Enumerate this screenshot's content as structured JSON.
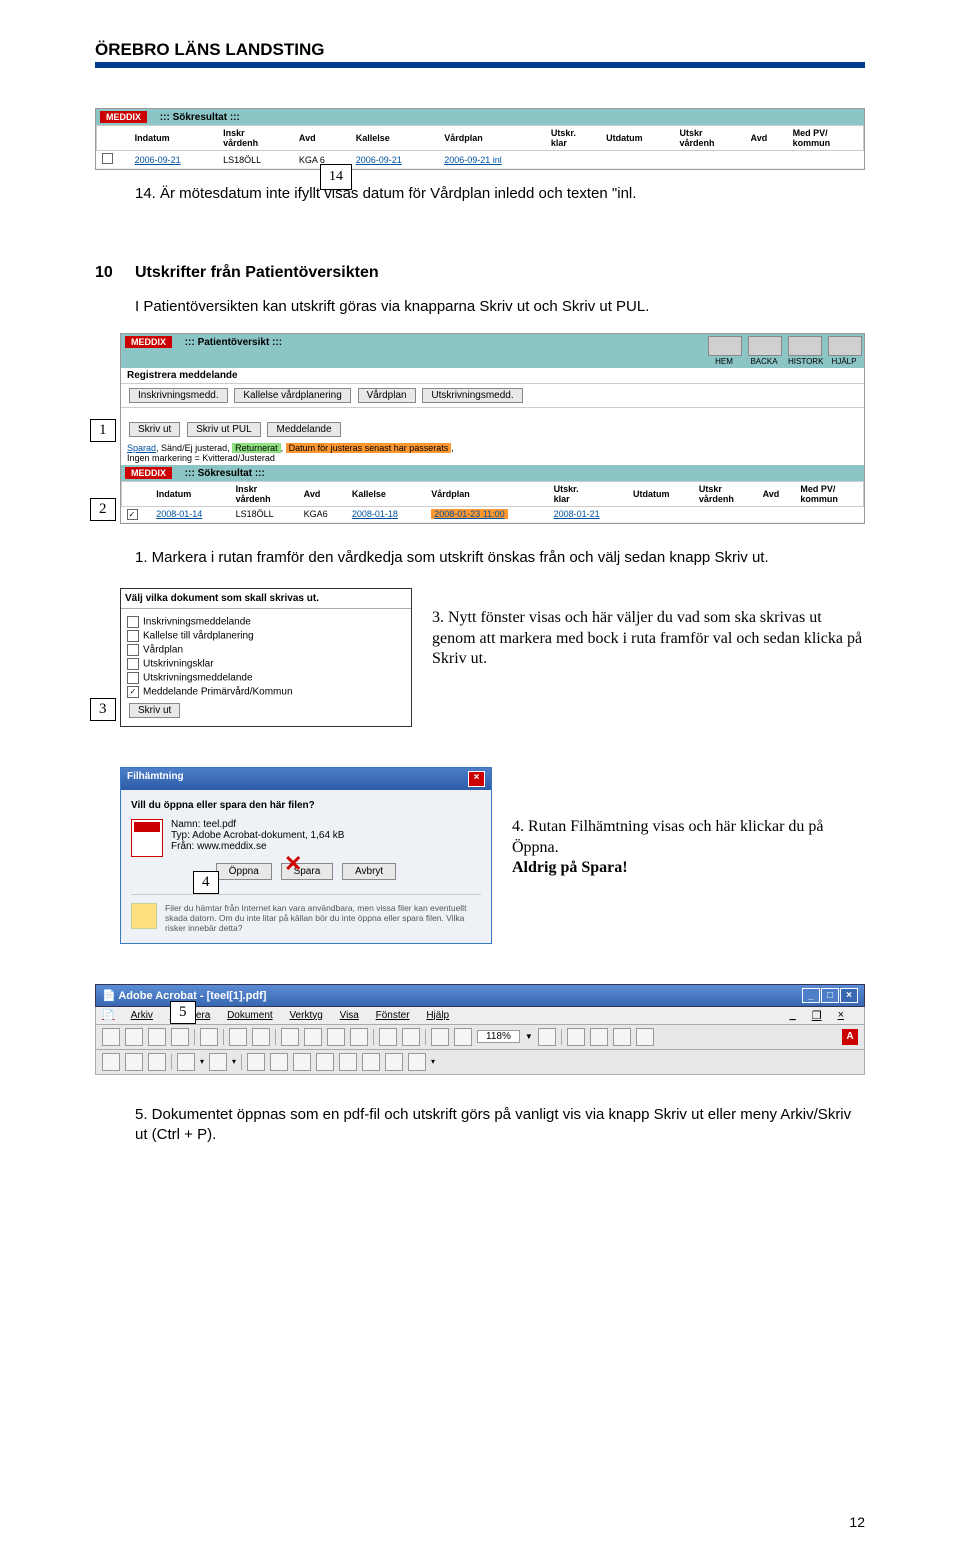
{
  "header": {
    "org": "ÖREBRO LÄNS LANDSTING"
  },
  "sokresultat": {
    "title": "Sökresultat",
    "meddix": "MEDDIX",
    "cols": [
      "Indatum",
      "Inskr\nvårdenh",
      "Avd",
      "Kallelse",
      "Vårdplan",
      "Utskr.\nklar",
      "Utdatum",
      "Utskr\nvårdenh",
      "Avd",
      "Med PV/\nkommun"
    ],
    "row": [
      "2006-09-21",
      "LS18ÖLL",
      "KGA 6",
      "2006-09-21",
      "2006-09-21 inl",
      "",
      "",
      "",
      "",
      ""
    ]
  },
  "callout14": "14",
  "step14_text": "14. Är mötesdatum inte ifyllt visas datum för Vårdplan inledd och texten \"inl.",
  "section10": {
    "num": "10",
    "title": "Utskrifter från Patientöversikten",
    "intro": "I Patientöversikten kan utskrift göras via knapparna Skriv ut och Skriv ut PUL."
  },
  "patientoversikt": {
    "title": "Patientöversikt",
    "meddix": "MEDDIX",
    "nav_icons": [
      "HEM",
      "BACKA",
      "HISTORK",
      "HJÄLP"
    ],
    "registrera": "Registrera meddelande",
    "tabs": [
      "Inskrivningsmedd.",
      "Kallelse vårdplanering",
      "Vårdplan",
      "Utskrivningsmedd."
    ],
    "buttons": [
      "Skriv ut",
      "Skriv ut PUL",
      "Meddelande"
    ],
    "status_line_parts": {
      "sparad": "Sparad",
      "sep1": ", ",
      "sand": "Sänd/Ej justerad",
      "sep2": ", ",
      "returnerat": "Returnerat",
      "sep3": ", ",
      "datum_passerat": "Datum för justeras senast har passerats",
      "sep4": ","
    },
    "marker_line": "Ingen markering = Kvitterad/Justerad",
    "sok_title": "Sökresultat",
    "row": [
      "2008-01-14",
      "LS18ÖLL",
      "KGA6",
      "2008-01-18",
      "2008-01-23 11:00",
      "2008-01-21",
      "",
      "",
      "",
      ""
    ]
  },
  "callout1": "1",
  "callout2": "2",
  "step1_text": "1. Markera i rutan framför den vårdkedja som utskrift önskas från och välj sedan knapp Skriv ut.",
  "print_dialog": {
    "title": "Välj vilka dokument som skall skrivas ut.",
    "options": [
      "Inskrivningsmeddelande",
      "Kallelse till vårdplanering",
      "Vårdplan",
      "Utskrivningsklar",
      "Utskrivningsmeddelande",
      "Meddelande Primärvård/Kommun"
    ],
    "checked_idx": 5,
    "button": "Skriv ut"
  },
  "callout3": "3",
  "step3_text": "3. Nytt fönster visas och här väljer du vad som ska skrivas ut genom att markera med bock i ruta framför val och sedan klicka på Skriv ut.",
  "filedl": {
    "title": "Filhämtning",
    "question": "Vill du öppna eller spara den här filen?",
    "namn_label": "Namn:",
    "namn": "teel.pdf",
    "typ_label": "Typ:",
    "typ": "Adobe Acrobat-dokument, 1,64 kB",
    "fran_label": "Från:",
    "fran": "www.meddix.se",
    "btn_open": "Öppna",
    "btn_save": "Spara",
    "btn_cancel": "Avbryt",
    "footer": "Filer du hämtar från Internet kan vara användbara, men vissa filer kan eventuellt skada datorn. Om du inte litar på källan bör du inte öppna eller spara filen. Vilka risker innebär detta?"
  },
  "callout4": "4",
  "step4_text_a": "4. Rutan Filhämtning visas och här klickar du på Öppna.",
  "step4_text_b": "Aldrig på Spara!",
  "acrobat": {
    "title": "Adobe Acrobat - [teel[1].pdf]",
    "menu": [
      "Arkiv",
      "Redigera",
      "Dokument",
      "Verktyg",
      "Visa",
      "Fönster",
      "Hjälp"
    ],
    "zoom": "118%"
  },
  "callout5": "5",
  "step5_text": "5. Dokumentet öppnas som en pdf-fil och utskrift görs på vanligt vis via knapp Skriv ut eller meny Arkiv/Skriv ut (Ctrl + P).",
  "page_number": "12"
}
